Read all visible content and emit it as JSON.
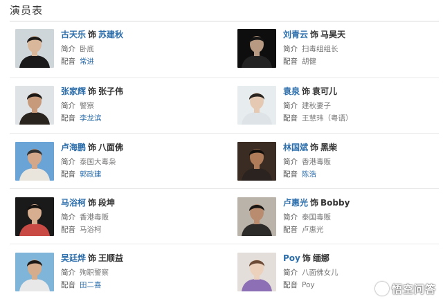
{
  "section_title": "演员表",
  "labels": {
    "for": "饰",
    "intro": "简介",
    "voice": "配音"
  },
  "cast": [
    {
      "actor": "古天乐",
      "role": "苏建秋",
      "role_link": true,
      "intro": "卧底",
      "voice": "常进",
      "voice_link": true,
      "photo": {
        "bg": "#cfd6da",
        "skin": "#d9b79b",
        "hair": "#1e1a18",
        "clothes": "#1a1a1a"
      }
    },
    {
      "actor": "刘青云",
      "role": "马昊天",
      "role_link": false,
      "intro": "扫毒组组长",
      "voice": "胡健",
      "voice_link": false,
      "photo": {
        "bg": "#0e0e0e",
        "skin": "#b89a82",
        "hair": "#141414",
        "clothes": "#232323"
      }
    },
    {
      "actor": "张家辉",
      "role": "张子伟",
      "role_link": false,
      "intro": "警察",
      "voice": "李龙滨",
      "voice_link": true,
      "photo": {
        "bg": "#dfe3e6",
        "skin": "#c69a7b",
        "hair": "#1b1714",
        "clothes": "#2a241f"
      }
    },
    {
      "actor": "袁泉",
      "role": "袁可儿",
      "role_link": false,
      "intro": "建秋妻子",
      "voice": "王慧玮（粤语）",
      "voice_link": false,
      "photo": {
        "bg": "#e7ecee",
        "skin": "#e6c9b3",
        "hair": "#2a2420",
        "clothes": "#dde3e6"
      }
    },
    {
      "actor": "卢海鹏",
      "role": "八面佛",
      "role_link": false,
      "intro": "泰国大毒枭",
      "voice": "郭政建",
      "voice_link": true,
      "photo": {
        "bg": "#6aa4d6",
        "skin": "#d3a789",
        "hair": "#2f2f2f",
        "clothes": "#e9e4dc"
      }
    },
    {
      "actor": "林国斌",
      "role": "黑柴",
      "role_link": false,
      "intro": "香港毒贩",
      "voice": "陈浩",
      "voice_link": true,
      "photo": {
        "bg": "#3a2c22",
        "skin": "#b07b58",
        "hair": "#120e0c",
        "clothes": "#2b231f"
      }
    },
    {
      "actor": "马浴柯",
      "role": "段坤",
      "role_link": false,
      "intro": "香港毒贩",
      "voice": "马浴柯",
      "voice_link": false,
      "photo": {
        "bg": "#1a1a1a",
        "skin": "#d8ae90",
        "hair": "#161210",
        "clothes": "#c94a45"
      }
    },
    {
      "actor": "卢惠光",
      "role": "Bobby",
      "role_link": false,
      "intro": "泰国毒贩",
      "voice": "卢惠光",
      "voice_link": false,
      "photo": {
        "bg": "#b9b3aa",
        "skin": "#b98c6f",
        "hair": "#1a1614",
        "clothes": "#2d2b29"
      }
    },
    {
      "actor": "吴廷烨",
      "role": "王顺益",
      "role_link": false,
      "intro": "殉职警察",
      "voice": "田二喜",
      "voice_link": true,
      "photo": {
        "bg": "#7fb5d9",
        "skin": "#d6ad8c",
        "hair": "#1d1916",
        "clothes": "#e8e8e8"
      }
    },
    {
      "actor": "Poy",
      "role": "缅娜",
      "role_link": false,
      "intro": "八面佛女儿",
      "voice": "Poy",
      "voice_link": false,
      "photo": {
        "bg": "#e4dedb",
        "skin": "#ecd1bd",
        "hair": "#6b4a36",
        "clothes": "#8c6fb5"
      }
    }
  ],
  "watermark": "悟空问答"
}
